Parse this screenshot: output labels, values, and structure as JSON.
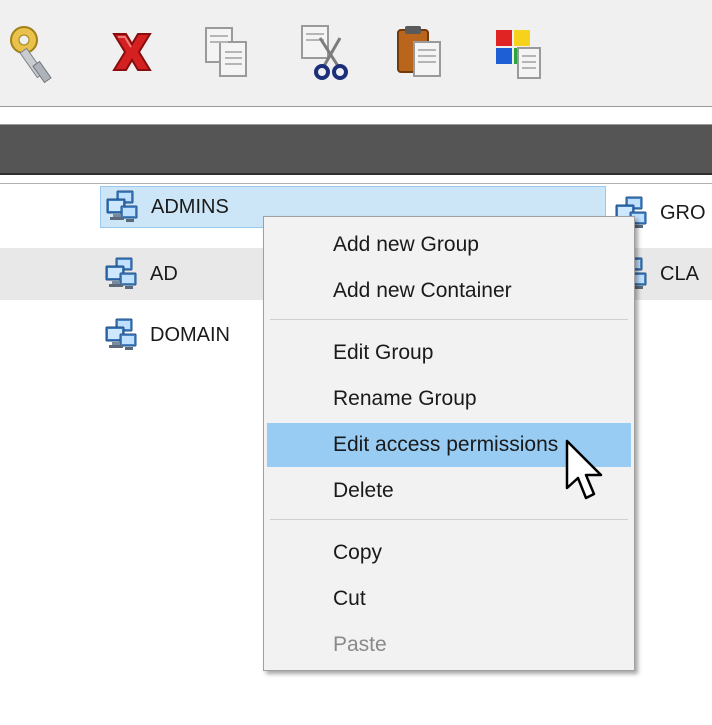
{
  "toolbar": {
    "buttons": [
      {
        "icon": "keys-icon"
      },
      {
        "icon": "delete-icon"
      },
      {
        "icon": "copy-icon"
      },
      {
        "icon": "cut-icon"
      },
      {
        "icon": "paste-icon"
      },
      {
        "icon": "properties-icon"
      }
    ]
  },
  "items": {
    "admins": "ADMINS",
    "ad": "AD",
    "domain": "DOMAIN",
    "gro": "GRO",
    "cla": "CLA"
  },
  "context_menu": {
    "add_group": "Add new Group",
    "add_container": "Add new Container",
    "edit_group": "Edit Group",
    "rename_group": "Rename Group",
    "edit_permissions": "Edit access permissions",
    "delete": "Delete",
    "copy": "Copy",
    "cut": "Cut",
    "paste": "Paste"
  },
  "colors": {
    "selection": "#cde6f7",
    "menu_highlight": "#99ccf3",
    "header_bar": "#555555",
    "row_band": "#e8e8e8"
  }
}
